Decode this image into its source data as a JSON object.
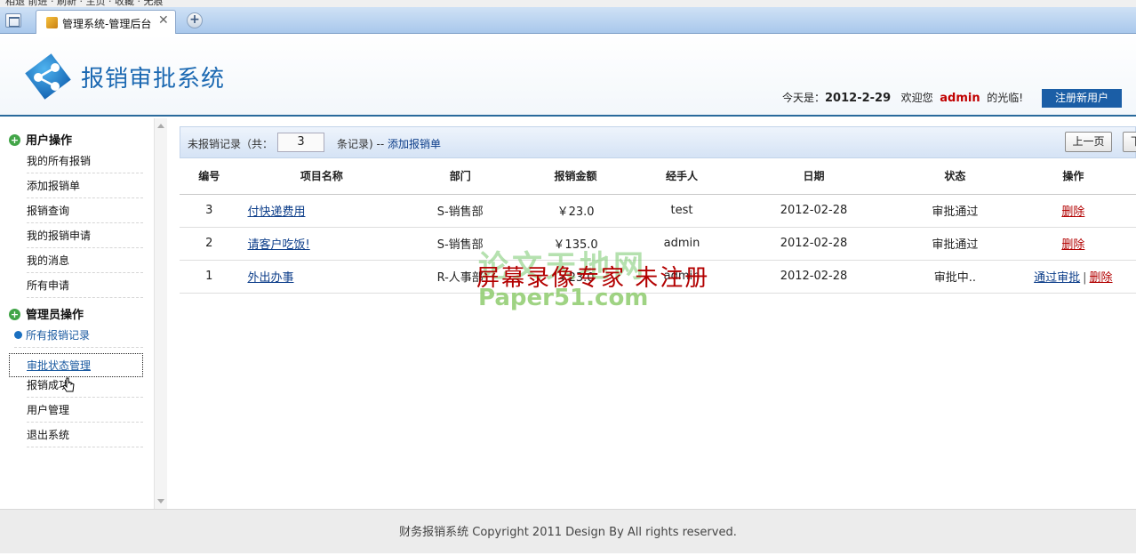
{
  "browser": {
    "menubar_text": "相退 前进 · 刷新 · 主页 · 收藏 · 无痕",
    "tab_title": "管理系统-管理后台",
    "tab_close": "✕",
    "new_tab": "+"
  },
  "header": {
    "app_title": "报销审批系统",
    "today_label": "今天是：",
    "today_date": "2012-2-29",
    "welcome_prefix": "欢迎您",
    "username": "admin",
    "welcome_suffix": "的光临!",
    "register_button": "注册新用户"
  },
  "sidebar": {
    "user_section": "用户操作",
    "user_items": [
      "我的所有报销",
      "添加报销单",
      "报销查询",
      "我的报销申请",
      "我的消息",
      "所有申请"
    ],
    "admin_section": "管理员操作",
    "admin_items": [
      "所有报销记录",
      "审批状态管理",
      "报销成功",
      "用户管理",
      "退出系统"
    ]
  },
  "toolbar": {
    "records_prefix": "未报销记录（共：",
    "records_count": "3",
    "records_suffix": "条记录) --",
    "add_link": "添加报销单",
    "prev_button": "上一页",
    "next_button": "下"
  },
  "table": {
    "headers": [
      "编号",
      "项目名称",
      "部门",
      "报销金额",
      "经手人",
      "日期",
      "状态",
      "操作"
    ],
    "rows": [
      {
        "id": "3",
        "name": "付快递费用",
        "dept": "S-销售部",
        "amount": "￥23.0",
        "handler": "test",
        "date": "2012-02-28",
        "status": "审批通过",
        "approve": "",
        "delete": "删除"
      },
      {
        "id": "2",
        "name": "请客户吃饭!",
        "dept": "S-销售部",
        "amount": "￥135.0",
        "handler": "admin",
        "date": "2012-02-28",
        "status": "审批通过",
        "approve": "",
        "delete": "删除"
      },
      {
        "id": "1",
        "name": "外出办事",
        "dept": "R-人事部",
        "amount": "￥23.0",
        "handler": "admin",
        "date": "2012-02-28",
        "status": "审批中..",
        "approve": "通过审批",
        "delete": "删除"
      }
    ]
  },
  "watermark": {
    "line1": "论文天地网",
    "line2": "屏幕录像专家  未注册",
    "line3": "Paper51.com"
  },
  "footer": {
    "text": "财务报销系统 Copyright 2011 Design By All rights reserved."
  },
  "colors": {
    "brand_blue": "#1c69b2",
    "header_rule": "#2a6a9c",
    "link": "#0d3e8a",
    "danger": "#b20000",
    "user_highlight": "#c00000",
    "register_bg": "#1b5ea6"
  }
}
